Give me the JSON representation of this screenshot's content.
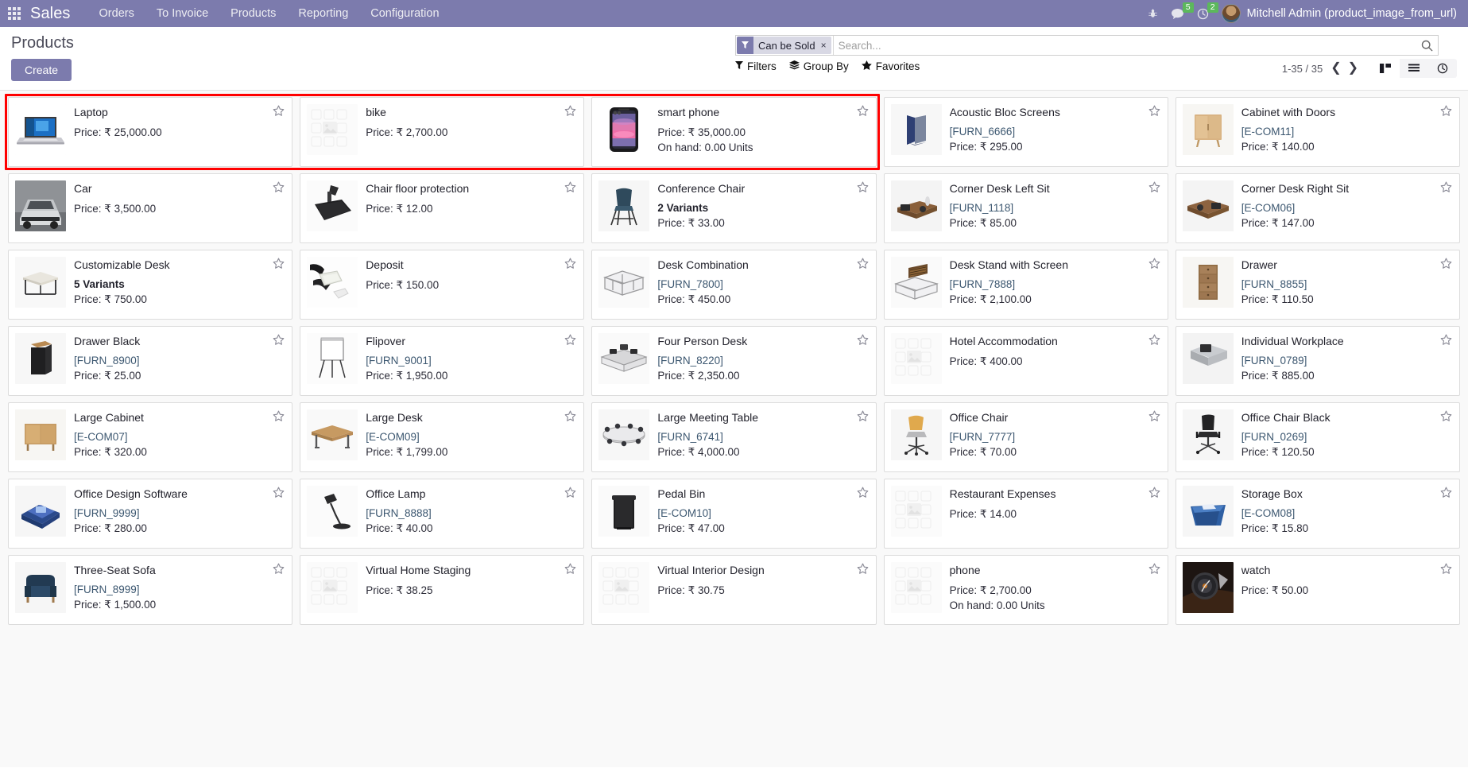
{
  "navbar": {
    "apps_icon": "apps-grid-icon",
    "brand": "Sales",
    "menu": [
      {
        "label": "Orders"
      },
      {
        "label": "To Invoice"
      },
      {
        "label": "Products"
      },
      {
        "label": "Reporting"
      },
      {
        "label": "Configuration"
      }
    ],
    "bug_icon": "bug-icon",
    "messages_icon": "chat-bubble-icon",
    "messages_count": "5",
    "activities_icon": "clock-icon",
    "activities_count": "2",
    "avatar_icon": "user-avatar",
    "user_name": "Mitchell Admin (product_image_from_url)"
  },
  "control_panel": {
    "title": "Products",
    "create_label": "Create",
    "search": {
      "facet_icon": "filter-funnel-icon",
      "facet_label": "Can be Sold",
      "facet_remove": "×",
      "placeholder": "Search...",
      "value": "",
      "search_icon": "search-icon"
    },
    "filters": [
      {
        "label": "Filters",
        "icon": "filter-funnel-icon"
      },
      {
        "label": "Group By",
        "icon": "layers-icon"
      },
      {
        "label": "Favorites",
        "icon": "star-icon"
      }
    ],
    "pager": {
      "range": "1-35 / 35",
      "prev_icon": "chevron-left-icon",
      "next_icon": "chevron-right-icon"
    },
    "views": [
      {
        "name": "kanban-view",
        "icon": "kanban-icon",
        "active": true
      },
      {
        "name": "list-view",
        "icon": "list-icon",
        "active": false
      },
      {
        "name": "activity-view",
        "icon": "clock-icon",
        "active": false
      }
    ]
  },
  "colors": {
    "brand_purple": "#7C7BAD",
    "highlight_red": "#ff0000",
    "badge_green": "#5cb85c",
    "code_blue": "#3c5770"
  },
  "highlight": {
    "enabled": true,
    "note": "red rectangle around first three cards of row 1"
  },
  "products": [
    {
      "name": "Laptop",
      "code": "",
      "variants": "",
      "price": "Price: ₹ 25,000.00",
      "onhand": "",
      "img": "laptop"
    },
    {
      "name": "bike",
      "code": "",
      "variants": "",
      "price": "Price: ₹ 2,700.00",
      "onhand": "",
      "img": "placeholder"
    },
    {
      "name": "smart phone",
      "code": "",
      "variants": "",
      "price": "Price: ₹ 35,000.00",
      "onhand": "On hand: 0.00 Units",
      "img": "smartphone"
    },
    {
      "name": "Acoustic Bloc Screens",
      "code": "[FURN_6666]",
      "variants": "",
      "price": "Price: ₹ 295.00",
      "onhand": "",
      "img": "screens"
    },
    {
      "name": "Cabinet with Doors",
      "code": "[E-COM11]",
      "variants": "",
      "price": "Price: ₹ 140.00",
      "onhand": "",
      "img": "cabinet"
    },
    {
      "name": "Car",
      "code": "",
      "variants": "",
      "price": "Price: ₹ 3,500.00",
      "onhand": "",
      "img": "car"
    },
    {
      "name": "Chair floor protection",
      "code": "",
      "variants": "",
      "price": "Price: ₹ 12.00",
      "onhand": "",
      "img": "floormat"
    },
    {
      "name": "Conference Chair",
      "code": "",
      "variants": "2 Variants",
      "price": "Price: ₹ 33.00",
      "onhand": "",
      "img": "confchair"
    },
    {
      "name": "Corner Desk Left Sit",
      "code": "[FURN_1118]",
      "variants": "",
      "price": "Price: ₹ 85.00",
      "onhand": "",
      "img": "cornerdesk"
    },
    {
      "name": "Corner Desk Right Sit",
      "code": "[E-COM06]",
      "variants": "",
      "price": "Price: ₹ 147.00",
      "onhand": "",
      "img": "cornerdesk2"
    },
    {
      "name": "Customizable Desk",
      "code": "",
      "variants": "5 Variants",
      "price": "Price: ₹ 750.00",
      "onhand": "",
      "img": "customdesk"
    },
    {
      "name": "Deposit",
      "code": "",
      "variants": "",
      "price": "Price: ₹ 150.00",
      "onhand": "",
      "img": "deposit"
    },
    {
      "name": "Desk Combination",
      "code": "[FURN_7800]",
      "variants": "",
      "price": "Price: ₹ 450.00",
      "onhand": "",
      "img": "deskcombo"
    },
    {
      "name": "Desk Stand with Screen",
      "code": "[FURN_7888]",
      "variants": "",
      "price": "Price: ₹ 2,100.00",
      "onhand": "",
      "img": "deskstand"
    },
    {
      "name": "Drawer",
      "code": "[FURN_8855]",
      "variants": "",
      "price": "Price: ₹ 110.50",
      "onhand": "",
      "img": "drawer"
    },
    {
      "name": "Drawer Black",
      "code": "[FURN_8900]",
      "variants": "",
      "price": "Price: ₹ 25.00",
      "onhand": "",
      "img": "drawerblack"
    },
    {
      "name": "Flipover",
      "code": "[FURN_9001]",
      "variants": "",
      "price": "Price: ₹ 1,950.00",
      "onhand": "",
      "img": "flipover"
    },
    {
      "name": "Four Person Desk",
      "code": "[FURN_8220]",
      "variants": "",
      "price": "Price: ₹ 2,350.00",
      "onhand": "",
      "img": "fourperson"
    },
    {
      "name": "Hotel Accommodation",
      "code": "",
      "variants": "",
      "price": "Price: ₹ 400.00",
      "onhand": "",
      "img": "placeholder"
    },
    {
      "name": "Individual Workplace",
      "code": "[FURN_0789]",
      "variants": "",
      "price": "Price: ₹ 885.00",
      "onhand": "",
      "img": "workplace"
    },
    {
      "name": "Large Cabinet",
      "code": "[E-COM07]",
      "variants": "",
      "price": "Price: ₹ 320.00",
      "onhand": "",
      "img": "largecabinet"
    },
    {
      "name": "Large Desk",
      "code": "[E-COM09]",
      "variants": "",
      "price": "Price: ₹ 1,799.00",
      "onhand": "",
      "img": "largedesk"
    },
    {
      "name": "Large Meeting Table",
      "code": "[FURN_6741]",
      "variants": "",
      "price": "Price: ₹ 4,000.00",
      "onhand": "",
      "img": "meetingtable"
    },
    {
      "name": "Office Chair",
      "code": "[FURN_7777]",
      "variants": "",
      "price": "Price: ₹ 70.00",
      "onhand": "",
      "img": "officechair"
    },
    {
      "name": "Office Chair Black",
      "code": "[FURN_0269]",
      "variants": "",
      "price": "Price: ₹ 120.50",
      "onhand": "",
      "img": "officechairblack"
    },
    {
      "name": "Office Design Software",
      "code": "[FURN_9999]",
      "variants": "",
      "price": "Price: ₹ 280.00",
      "onhand": "",
      "img": "software"
    },
    {
      "name": "Office Lamp",
      "code": "[FURN_8888]",
      "variants": "",
      "price": "Price: ₹ 40.00",
      "onhand": "",
      "img": "lamp"
    },
    {
      "name": "Pedal Bin",
      "code": "[E-COM10]",
      "variants": "",
      "price": "Price: ₹ 47.00",
      "onhand": "",
      "img": "pedalbin"
    },
    {
      "name": "Restaurant Expenses",
      "code": "",
      "variants": "",
      "price": "Price: ₹ 14.00",
      "onhand": "",
      "img": "placeholder"
    },
    {
      "name": "Storage Box",
      "code": "[E-COM08]",
      "variants": "",
      "price": "Price: ₹ 15.80",
      "onhand": "",
      "img": "storagebox"
    },
    {
      "name": "Three-Seat Sofa",
      "code": "[FURN_8999]",
      "variants": "",
      "price": "Price: ₹ 1,500.00",
      "onhand": "",
      "img": "sofa"
    },
    {
      "name": "Virtual Home Staging",
      "code": "",
      "variants": "",
      "price": "Price: ₹ 38.25",
      "onhand": "",
      "img": "placeholder"
    },
    {
      "name": "Virtual Interior Design",
      "code": "",
      "variants": "",
      "price": "Price: ₹ 30.75",
      "onhand": "",
      "img": "placeholder"
    },
    {
      "name": "phone",
      "code": "",
      "variants": "",
      "price": "Price: ₹ 2,700.00",
      "onhand": "On hand: 0.00 Units",
      "img": "placeholder"
    },
    {
      "name": "watch",
      "code": "",
      "variants": "",
      "price": "Price: ₹ 50.00",
      "onhand": "",
      "img": "watch"
    }
  ]
}
